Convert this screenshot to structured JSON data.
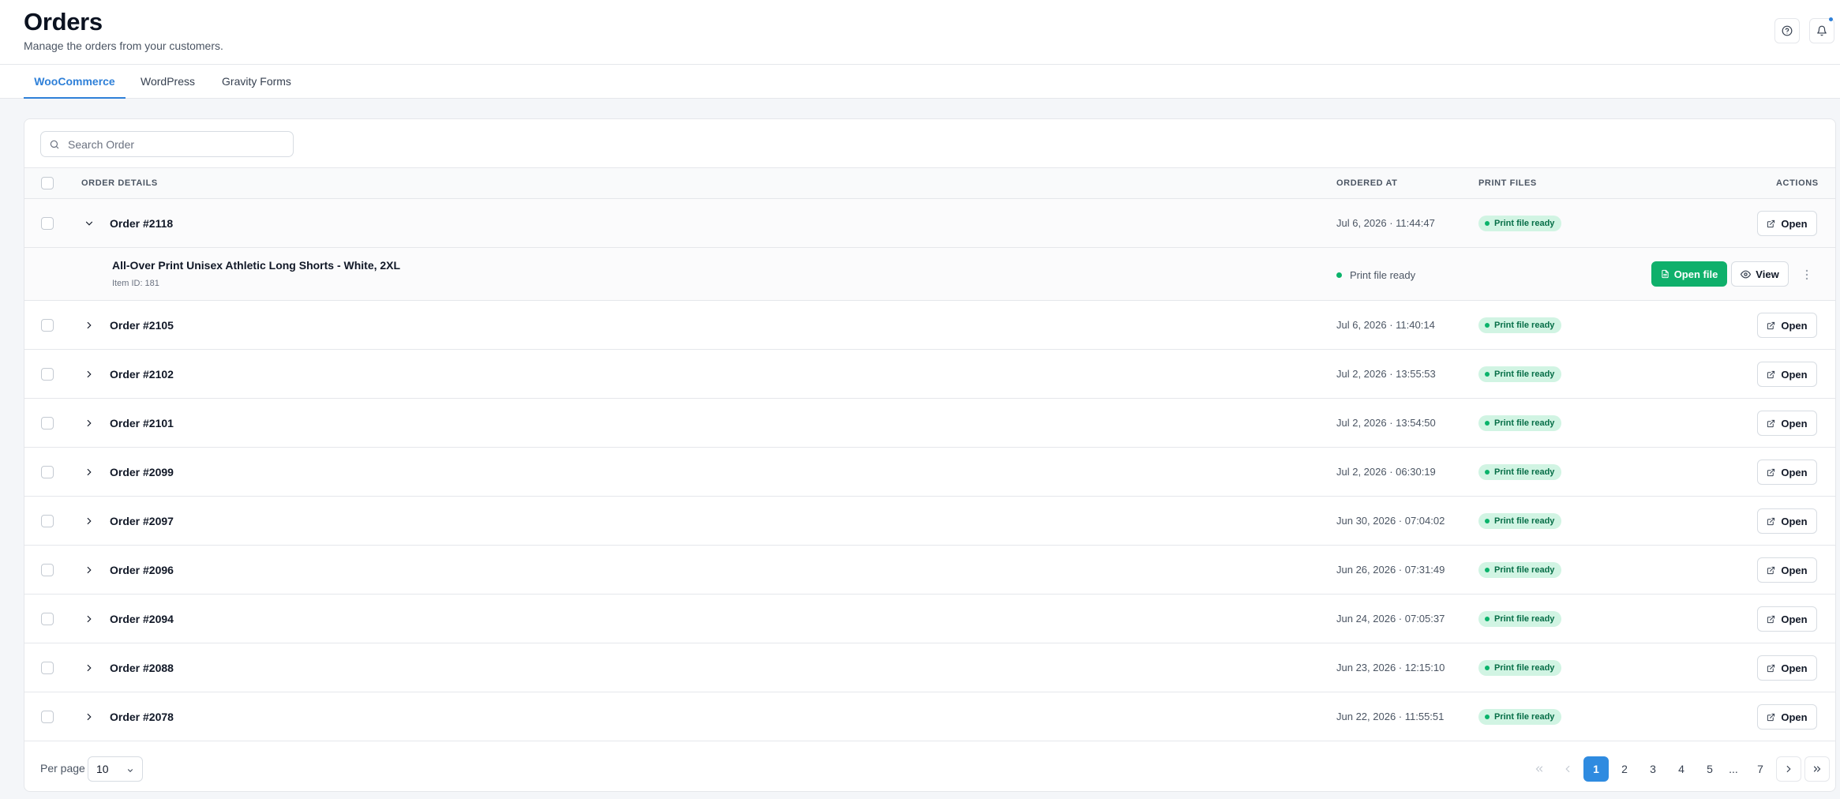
{
  "header": {
    "title": "Orders",
    "subtitle": "Manage the orders from your customers."
  },
  "tabs": [
    {
      "label": "WooCommerce",
      "active": true
    },
    {
      "label": "WordPress",
      "active": false
    },
    {
      "label": "Gravity Forms",
      "active": false
    }
  ],
  "search": {
    "placeholder": "Search Order"
  },
  "table": {
    "headers": {
      "order_details": "ORDER DETAILS",
      "ordered_at": "ORDERED AT",
      "print_files": "PRINT FILES",
      "actions": "ACTIONS"
    },
    "open_label": "Open",
    "rows": [
      {
        "order": "Order #2118",
        "date": "Jul 6, 2026 · 11:44:47",
        "status": "Print file ready",
        "expanded": true
      },
      {
        "order": "Order #2105",
        "date": "Jul 6, 2026 · 11:40:14",
        "status": "Print file ready"
      },
      {
        "order": "Order #2102",
        "date": "Jul 2, 2026 · 13:55:53",
        "status": "Print file ready"
      },
      {
        "order": "Order #2101",
        "date": "Jul 2, 2026 · 13:54:50",
        "status": "Print file ready"
      },
      {
        "order": "Order #2099",
        "date": "Jul 2, 2026 · 06:30:19",
        "status": "Print file ready"
      },
      {
        "order": "Order #2097",
        "date": "Jun 30, 2026 · 07:04:02",
        "status": "Print file ready"
      },
      {
        "order": "Order #2096",
        "date": "Jun 26, 2026 · 07:31:49",
        "status": "Print file ready"
      },
      {
        "order": "Order #2094",
        "date": "Jun 24, 2026 · 07:05:37",
        "status": "Print file ready"
      },
      {
        "order": "Order #2088",
        "date": "Jun 23, 2026 · 12:15:10",
        "status": "Print file ready"
      },
      {
        "order": "Order #2078",
        "date": "Jun 22, 2026 · 11:55:51",
        "status": "Print file ready"
      }
    ],
    "expanded_item": {
      "name": "All-Over Print Unisex Athletic Long Shorts - White, 2XL",
      "item_id": "Item ID: 181",
      "status": "Print file ready",
      "open_file_label": "Open file",
      "view_label": "View"
    }
  },
  "footer": {
    "per_page_label": "Per page",
    "per_page_value": "10",
    "pages": [
      "1",
      "2",
      "3",
      "4",
      "5",
      "...",
      "7"
    ],
    "current_page": "1"
  },
  "colors": {
    "accent": "#2f80d8",
    "success": "#0fb06b",
    "badge_bg": "#d1f4e3",
    "badge_text": "#066e47"
  },
  "icons": [
    "help-circle-icon",
    "bell-icon",
    "search-icon",
    "chevron-down-icon",
    "chevron-right-icon",
    "external-link-icon",
    "file-icon",
    "eye-icon",
    "more-vertical-icon",
    "chevrons-left-icon",
    "chevron-left-icon",
    "chevrons-right-icon"
  ]
}
